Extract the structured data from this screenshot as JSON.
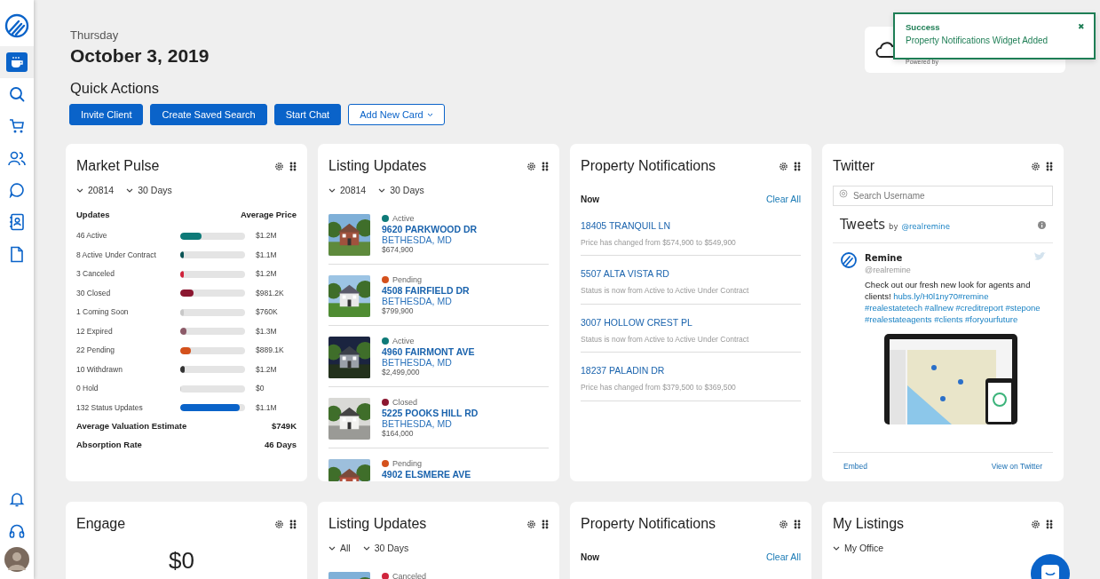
{
  "sidebar": {
    "items": [
      {
        "kind": "logo"
      },
      {
        "kind": "coffee",
        "selected": true
      },
      {
        "kind": "search",
        "selected": false
      },
      {
        "kind": "cart",
        "selected": false
      },
      {
        "kind": "people",
        "selected": false
      },
      {
        "kind": "chat",
        "selected": false
      },
      {
        "kind": "contacts",
        "selected": false
      },
      {
        "kind": "document",
        "selected": false
      }
    ],
    "bottom_items": [
      {
        "kind": "bell"
      },
      {
        "kind": "headset"
      },
      {
        "kind": "avatar"
      }
    ]
  },
  "header": {
    "day": "Thursday",
    "date": "October 3, 2019",
    "quick_actions_title": "Quick Actions",
    "quick_actions": [
      {
        "label": "Invite Client",
        "kind": "primary"
      },
      {
        "label": "Create Saved Search",
        "kind": "primary"
      },
      {
        "label": "Start Chat",
        "kind": "primary"
      },
      {
        "label": "Add New Card",
        "kind": "dropdown"
      }
    ]
  },
  "weather": {
    "powered_by": "Powered by"
  },
  "toast": {
    "title": "Success",
    "message": "Property Notifications Widget Added",
    "close": "✖"
  },
  "cards": [
    {
      "kind": "market_pulse",
      "title": "Market Pulse",
      "filters": [
        "20814",
        "30 Days"
      ],
      "columns": [
        "Updates",
        "Average Price"
      ],
      "rows": [
        {
          "label": "46 Active",
          "level": 0.33,
          "color": "#0e7a78",
          "price": "$1.2M"
        },
        {
          "label": "8 Active Under Contract",
          "level": 0.05,
          "color": "#0b5455",
          "price": "$1.1M"
        },
        {
          "label": "3 Canceled",
          "level": 0.02,
          "color": "#d0243c",
          "price": "$1.2M"
        },
        {
          "label": "30 Closed",
          "level": 0.21,
          "color": "#8b1730",
          "price": "$981.2K"
        },
        {
          "label": "1 Coming Soon",
          "level": 0.01,
          "color": "#c8c8c8",
          "price": "$760K"
        },
        {
          "label": "12 Expired",
          "level": 0.09,
          "color": "#8c5a68",
          "price": "$1.3M"
        },
        {
          "label": "22 Pending",
          "level": 0.16,
          "color": "#d4511c",
          "price": "$889.1K"
        },
        {
          "label": "10 Withdrawn",
          "level": 0.07,
          "color": "#333333",
          "price": "$1.2M"
        },
        {
          "label": "0 Hold",
          "level": 0,
          "price": "$0"
        },
        {
          "label": "132 Status Updates",
          "level": 0.92,
          "color": "#0a63c9",
          "price": "$1.1M"
        }
      ],
      "totals": [
        {
          "label": "Average Valuation Estimate",
          "value": "$749K"
        },
        {
          "label": "Absorption Rate",
          "value": "46 Days"
        }
      ]
    },
    {
      "kind": "listing_updates",
      "title": "Listing Updates",
      "filters": [
        "20814",
        "30 Days"
      ],
      "listings": [
        {
          "status": "Active",
          "color": "#0e7a78",
          "address": "9620 PARKWOOD DR",
          "city": "BETHESDA, MD",
          "price": "$674,900"
        },
        {
          "status": "Pending",
          "color": "#d4511c",
          "address": "4508 FAIRFIELD DR",
          "city": "BETHESDA, MD",
          "price": "$799,900"
        },
        {
          "status": "Active",
          "color": "#0e7a78",
          "address": "4960 FAIRMONT AVE",
          "city": "BETHESDA, MD",
          "price": "$2,499,000"
        },
        {
          "status": "Closed",
          "color": "#8b1730",
          "address": "5225 POOKS HILL RD",
          "city": "BETHESDA, MD",
          "price": "$164,000"
        },
        {
          "status": "Pending",
          "color": "#d4511c",
          "address": "4902 ELSMERE AVE"
        }
      ]
    },
    {
      "kind": "property_notifications",
      "title": "Property Notifications",
      "section": "Now",
      "action": "Clear All",
      "items": [
        {
          "address": "18405 TRANQUIL LN",
          "detail": "Price has changed from $574,900 to $549,900"
        },
        {
          "address": "5507 ALTA VISTA RD",
          "detail": "Status is now from Active to Active Under Contract"
        },
        {
          "address": "3007 HOLLOW CREST PL",
          "detail": "Status is now from Active to Active Under Contract"
        },
        {
          "address": "18237 PALADIN DR",
          "detail": "Price has changed from $379,500 to $369,500"
        }
      ]
    },
    {
      "kind": "twitter",
      "title": "Twitter",
      "search": {
        "placeholder": "Search Username"
      },
      "timeline": {
        "heading": "Tweets",
        "by": "by",
        "handle": "@realremine"
      },
      "tweet": {
        "name": "Remine",
        "handle": "@realremine",
        "text": "Check out our fresh new look for agents and clients!",
        "links": [
          "hubs.ly/H0l1ny70#remine",
          "#realestatetech",
          "#allnew",
          "#creditreport",
          "#stepone",
          "#realestateagents",
          "#clients",
          "#foryourfuture"
        ]
      },
      "footer": [
        "Embed",
        "View on Twitter"
      ]
    },
    {
      "kind": "engage",
      "title": "Engage",
      "value": "$0"
    },
    {
      "kind": "listing_updates",
      "title": "Listing Updates",
      "filters": [
        "All",
        "30 Days"
      ],
      "listings": [
        {
          "status": "Canceled",
          "color": "#d0243c"
        }
      ]
    },
    {
      "kind": "property_notifications",
      "title": "Property Notifications",
      "section": "Now",
      "action": "Clear All"
    },
    {
      "kind": "my_listings",
      "title": "My Listings",
      "filters": [
        "My Office"
      ]
    }
  ],
  "chat_launcher": {
    "kind": "chat"
  }
}
